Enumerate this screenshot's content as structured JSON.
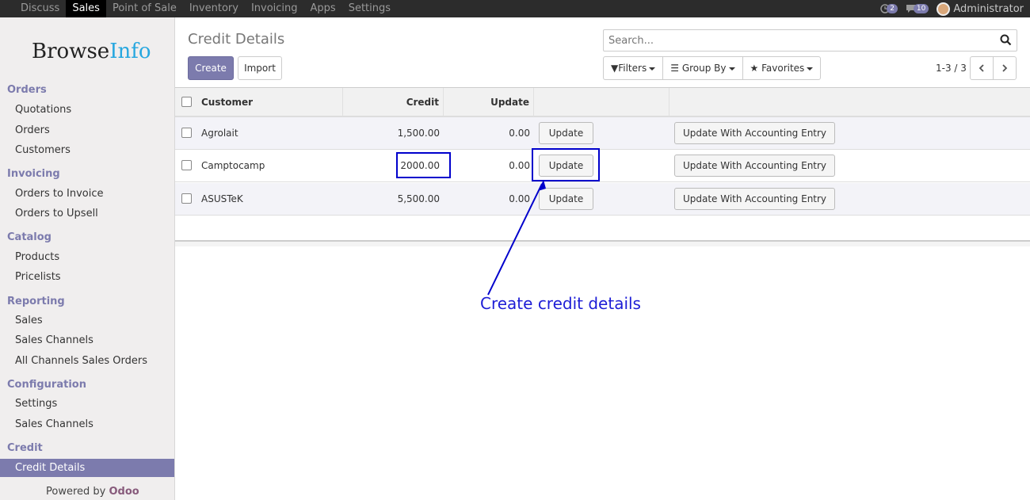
{
  "topbar": {
    "menu": [
      "Discuss",
      "Sales",
      "Point of Sale",
      "Inventory",
      "Invoicing",
      "Apps",
      "Settings"
    ],
    "active": "Sales",
    "activity_count": "2",
    "message_count": "10",
    "user": "Administrator"
  },
  "sidebar": {
    "logo_part1": "Browse",
    "logo_part2": "Info",
    "sections": [
      {
        "title": "Orders",
        "items": [
          "Quotations",
          "Orders",
          "Customers"
        ]
      },
      {
        "title": "Invoicing",
        "items": [
          "Orders to Invoice",
          "Orders to Upsell"
        ]
      },
      {
        "title": "Catalog",
        "items": [
          "Products",
          "Pricelists"
        ]
      },
      {
        "title": "Reporting",
        "items": [
          "Sales",
          "Sales Channels",
          "All Channels Sales Orders"
        ]
      },
      {
        "title": "Configuration",
        "items": [
          "Settings",
          "Sales Channels"
        ]
      },
      {
        "title": "Credit",
        "items": [
          "Credit Details"
        ]
      }
    ],
    "active_item": "Credit Details",
    "powered_by": "Powered by",
    "powered_brand": "Odoo"
  },
  "control_panel": {
    "breadcrumb": "Credit Details",
    "create_label": "Create",
    "import_label": "Import",
    "search_placeholder": "Search...",
    "filters_label": "Filters",
    "groupby_label": "Group By",
    "favorites_label": "Favorites",
    "pager": "1-3 / 3"
  },
  "table": {
    "headers": {
      "customer": "Customer",
      "credit": "Credit",
      "update": "Update"
    },
    "rows": [
      {
        "customer": "Agrolait",
        "credit": "1,500.00",
        "update": "0.00",
        "btn1": "Update",
        "btn2": "Update With Accounting Entry"
      },
      {
        "customer": "Camptocamp",
        "credit": "2000.00",
        "update": "0.00",
        "btn1": "Update",
        "btn2": "Update With Accounting Entry"
      },
      {
        "customer": "ASUSTeK",
        "credit": "5,500.00",
        "update": "0.00",
        "btn1": "Update",
        "btn2": "Update With Accounting Entry"
      }
    ]
  },
  "annotation": {
    "text": "Create credit details",
    "color": "#0000cc"
  },
  "colors": {
    "accent": "#7c7bad",
    "topbar": "#2c2c2c"
  }
}
